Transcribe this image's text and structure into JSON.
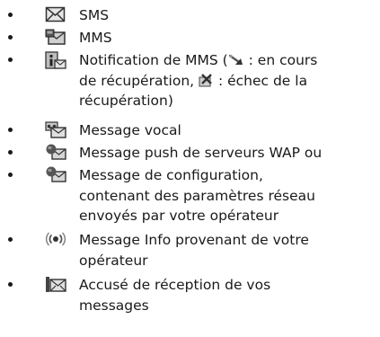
{
  "items": [
    {
      "icon": "envelope-icon",
      "lines": [
        "SMS"
      ]
    },
    {
      "icon": "mms-envelope-icon",
      "lines": [
        "MMS"
      ]
    },
    {
      "icon": "mms-notification-icon",
      "line1_pre": "Notification de MMS (",
      "line1_post": " : en cours",
      "line2_pre": "de récupération, ",
      "line2_post": " : échec de la",
      "line3": "récupération)",
      "inline_icons": [
        "retrieving-arrow-icon",
        "retrieval-failed-icon"
      ]
    },
    {
      "icon": "voice-message-icon",
      "lines": [
        "Message vocal"
      ]
    },
    {
      "icon": "wap-push-icon",
      "lines": [
        "Message push de serveurs WAP ou"
      ]
    },
    {
      "icon": "configuration-message-icon",
      "lines": [
        "Message de configuration,",
        "contenant des paramètres réseau",
        "envoyés par votre opérateur"
      ]
    },
    {
      "icon": "cell-broadcast-icon",
      "lines": [
        "Message Info provenant de votre",
        "opérateur"
      ]
    },
    {
      "icon": "delivery-report-icon",
      "lines": [
        "Accusé de réception de vos",
        "messages"
      ]
    }
  ]
}
